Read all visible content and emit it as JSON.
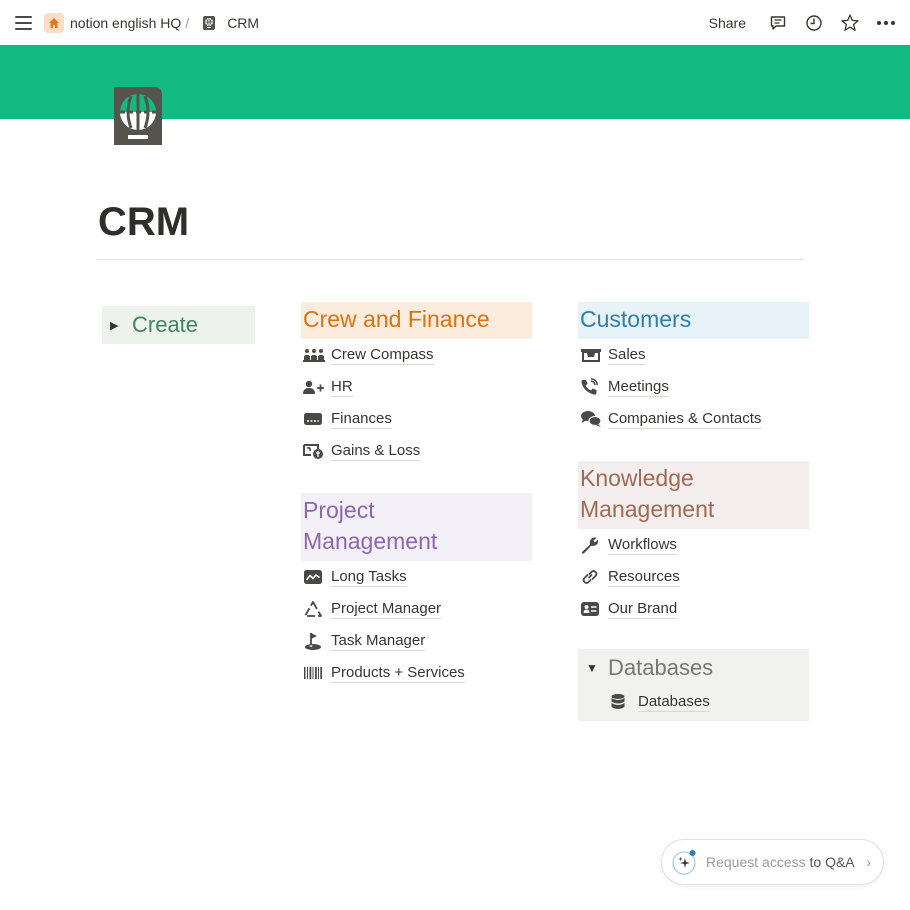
{
  "topbar": {
    "breadcrumbs": [
      {
        "label": "notion english HQ",
        "icon": "home-icon"
      },
      {
        "label": "CRM",
        "icon": "passport-icon"
      }
    ],
    "separator": "/",
    "share_label": "Share",
    "actions": [
      "comment-icon",
      "clock-icon",
      "star-icon",
      "more-icon"
    ]
  },
  "cover": {
    "color": "#12b981"
  },
  "page": {
    "icon": "passport-icon",
    "title": "CRM"
  },
  "create_toggle": {
    "label": "Create",
    "expanded": false,
    "color": "#448361"
  },
  "sections": {
    "crew_finance": {
      "heading": "Crew and Finance",
      "color": "#d9730d",
      "links": [
        {
          "label": "Crew Compass",
          "icon": "group-icon"
        },
        {
          "label": "HR",
          "icon": "add-user-icon"
        },
        {
          "label": "Finances",
          "icon": "credit-card-icon"
        },
        {
          "label": "Gains & Loss",
          "icon": "money-exchange-icon"
        }
      ]
    },
    "project_management": {
      "heading": "Project Management",
      "color": "#9065b0",
      "links": [
        {
          "label": "Long Tasks",
          "icon": "line-chart-icon"
        },
        {
          "label": "Project Manager",
          "icon": "recycle-triangle-icon"
        },
        {
          "label": "Task Manager",
          "icon": "golf-flag-icon"
        },
        {
          "label": "Products + Services",
          "icon": "barcode-icon"
        }
      ]
    },
    "customers": {
      "heading": "Customers",
      "color": "#337ea9",
      "links": [
        {
          "label": "Sales",
          "icon": "cash-register-icon"
        },
        {
          "label": "Meetings",
          "icon": "phone-call-icon"
        },
        {
          "label": "Companies & Contacts",
          "icon": "chat-bubbles-icon"
        }
      ]
    },
    "knowledge_management": {
      "heading": "Knowledge Management",
      "color": "#9f6b53",
      "links": [
        {
          "label": "Workflows",
          "icon": "wrench-icon"
        },
        {
          "label": "Resources",
          "icon": "link-icon"
        },
        {
          "label": "Our Brand",
          "icon": "id-card-icon"
        }
      ]
    },
    "databases": {
      "heading": "Databases",
      "expanded": true,
      "links": [
        {
          "label": "Databases",
          "icon": "database-icon"
        }
      ]
    }
  },
  "qa_button": {
    "label_muted": "Request access",
    "label_strong": " to Q&A"
  }
}
